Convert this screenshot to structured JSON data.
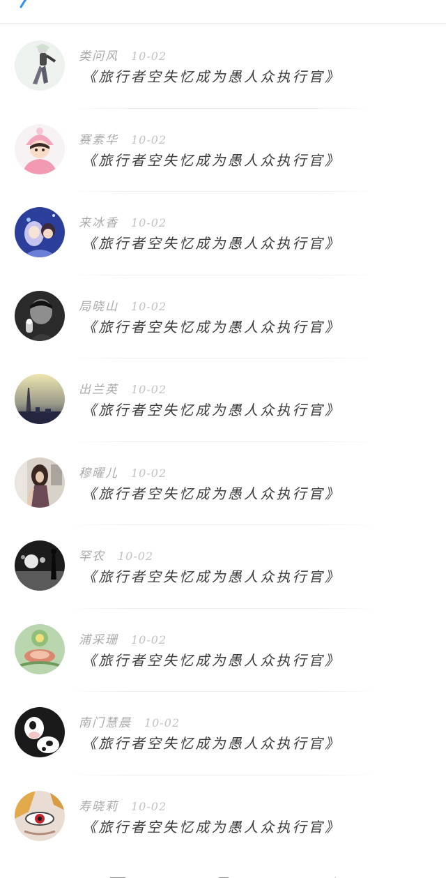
{
  "header": {
    "back_icon": "chevron-left-icon",
    "accent": "#2f8ff0"
  },
  "messages": [
    {
      "name": "类问风",
      "date": "10-02",
      "text": "《旅行者空失忆成为愚人众执行官》",
      "avatar": "cartoon-boy-avatar"
    },
    {
      "name": "赛素华",
      "date": "10-02",
      "text": "《旅行者空失忆成为愚人众执行官》",
      "avatar": "pink-hat-girl-avatar"
    },
    {
      "name": "来冰香",
      "date": "10-02",
      "text": "《旅行者空失忆成为愚人众执行官》",
      "avatar": "anime-couple-avatar"
    },
    {
      "name": "局晓山",
      "date": "10-02",
      "text": "《旅行者空失忆成为愚人众执行官》",
      "avatar": "dark-boy-avatar"
    },
    {
      "name": "出兰英",
      "date": "10-02",
      "text": "《旅行者空失忆成为愚人众执行官》",
      "avatar": "city-tower-avatar"
    },
    {
      "name": "穆曜儿",
      "date": "10-02",
      "text": "《旅行者空失忆成为愚人众执行官》",
      "avatar": "girl-sitting-avatar"
    },
    {
      "name": "罕农",
      "date": "10-02",
      "text": "《旅行者空失忆成为愚人众执行官》",
      "avatar": "night-street-avatar"
    },
    {
      "name": "浦采珊",
      "date": "10-02",
      "text": "《旅行者空失忆成为愚人众执行官》",
      "avatar": "cartoon-flower-avatar"
    },
    {
      "name": "南门慧晨",
      "date": "10-02",
      "text": "《旅行者空失忆成为愚人众执行官》",
      "avatar": "cow-avatar"
    },
    {
      "name": "寿晓莉",
      "date": "10-02",
      "text": "《旅行者空失忆成为愚人众执行官》",
      "avatar": "red-eye-anime-avatar"
    }
  ],
  "navbar": {
    "buttons": [
      "menu-icon",
      "home-icon",
      "back-icon"
    ]
  }
}
